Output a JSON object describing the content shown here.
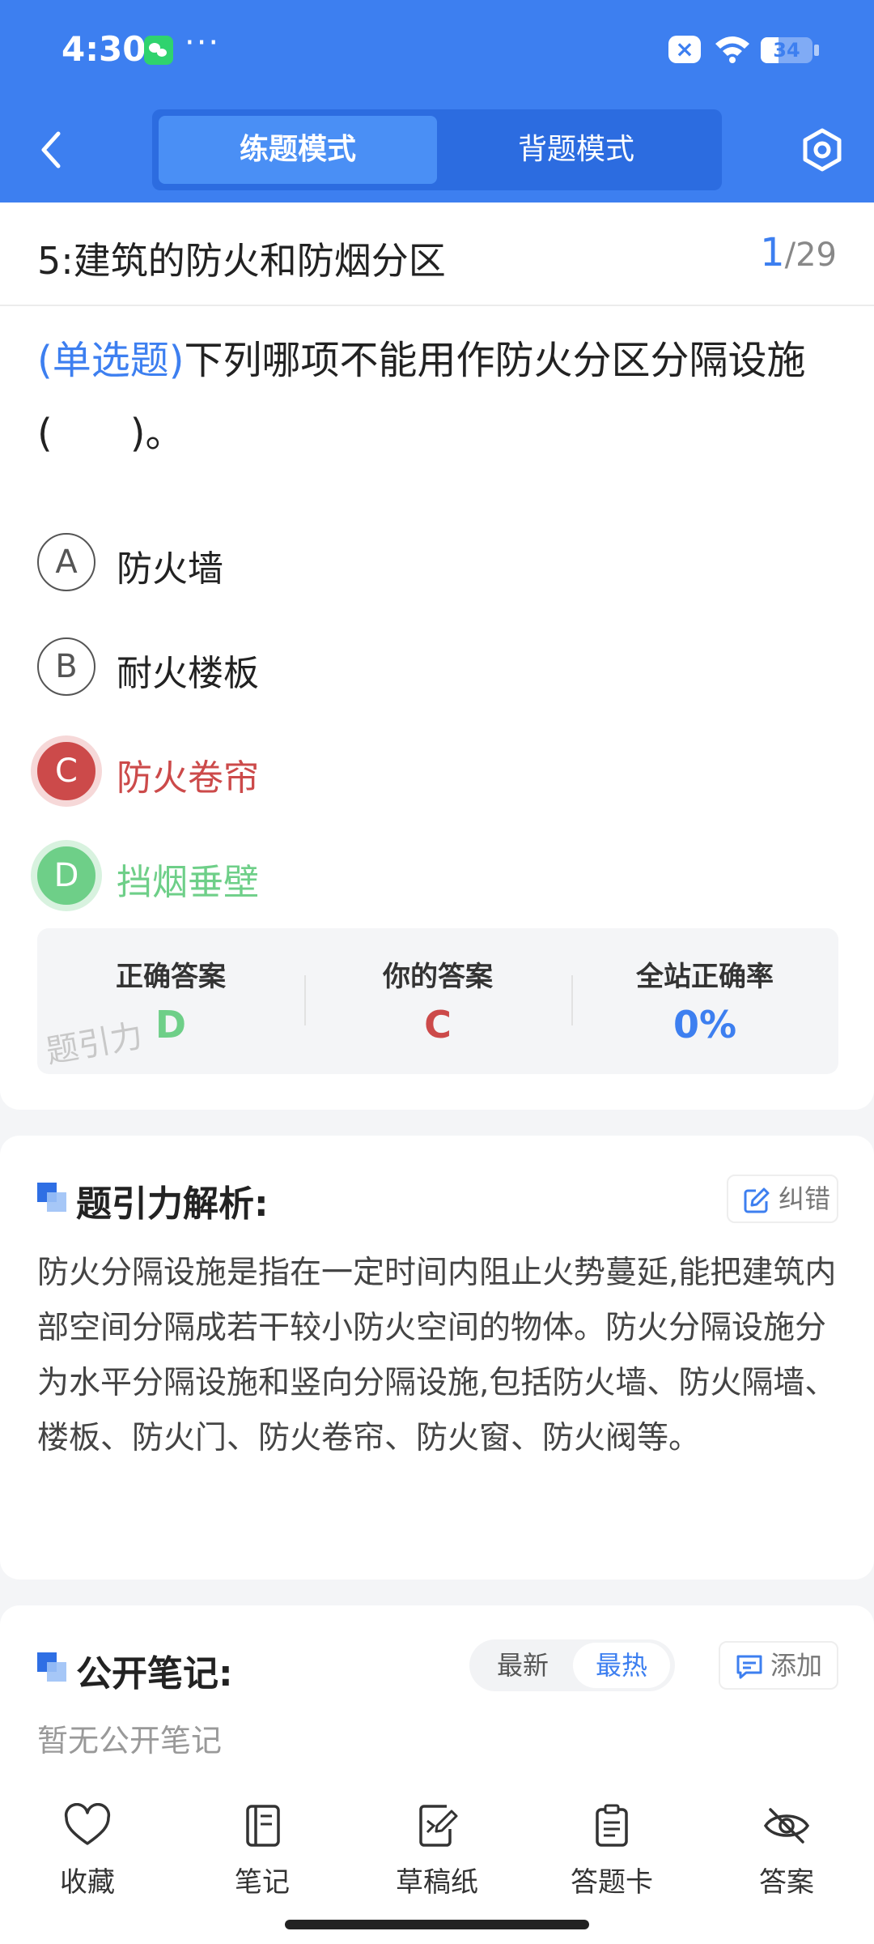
{
  "status_bar": {
    "time": "4:30",
    "battery": "34",
    "battery_level": 0.34,
    "overflow_dots": "···"
  },
  "nav": {
    "tabs": [
      {
        "label": "练题模式",
        "active": true
      },
      {
        "label": "背题模式",
        "active": false
      }
    ]
  },
  "question": {
    "chapter": "5:建筑的防火和防烟分区",
    "current": "1",
    "separator": "/",
    "total": "29",
    "type": "(单选题)",
    "stem": "下列哪项不能用作防火分区分隔设施(　　)。",
    "options": [
      {
        "letter": "A",
        "text": "防火墙",
        "state": "normal"
      },
      {
        "letter": "B",
        "text": "耐火楼板",
        "state": "normal"
      },
      {
        "letter": "C",
        "text": "防火卷帘",
        "state": "wrong"
      },
      {
        "letter": "D",
        "text": "挡烟垂壁",
        "state": "correct"
      }
    ],
    "summary": {
      "correct_label": "正确答案",
      "correct_value": "D",
      "yours_label": "你的答案",
      "yours_value": "C",
      "rate_label": "全站正确率",
      "rate_value": "0%"
    },
    "watermark": "题引力"
  },
  "analysis": {
    "title": "题引力解析:",
    "report_label": "纠错",
    "text": "防火分隔设施是指在一定时间内阻止火势蔓延,能把建筑内部空间分隔成若干较小防火空间的物体。防火分隔设施分为水平分隔设施和竖向分隔设施,包括防火墙、防火隔墙、楼板、防火门、防火卷帘、防火窗、防火阀等。"
  },
  "notes": {
    "title": "公开笔记:",
    "sort_newest": "最新",
    "sort_hottest": "最热",
    "add_label": "添加",
    "empty_text": "暂无公开笔记"
  },
  "toolbar": {
    "items": [
      {
        "label": "收藏",
        "icon": "heart-icon"
      },
      {
        "label": "笔记",
        "icon": "notebook-icon"
      },
      {
        "label": "草稿纸",
        "icon": "draft-paper-icon"
      },
      {
        "label": "答题卡",
        "icon": "answer-sheet-icon"
      },
      {
        "label": "答案",
        "icon": "eye-off-icon"
      }
    ]
  },
  "colors": {
    "accent": "#3d7ff0",
    "wrong": "#cc4a4a",
    "correct": "#6ecf88"
  }
}
